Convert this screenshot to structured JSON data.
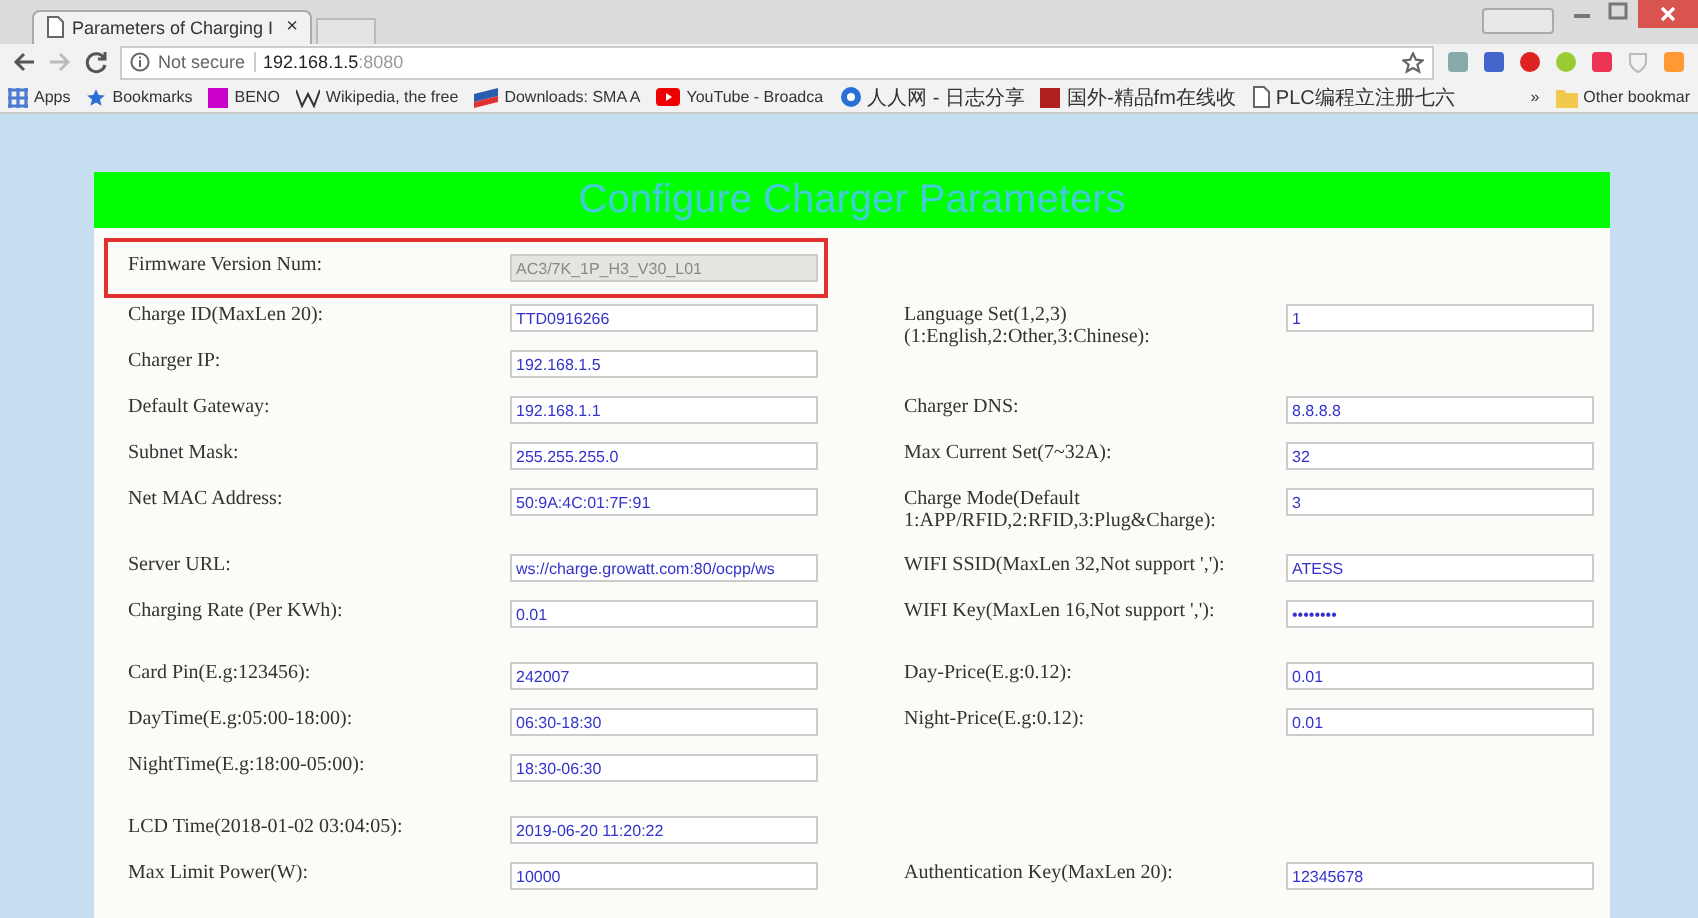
{
  "browser": {
    "tab": {
      "title": "Parameters of Charging I",
      "close": "×"
    },
    "address": {
      "security": "Not secure",
      "host": "192.168.1.5",
      "port": ":8080"
    },
    "bookmarks": [
      {
        "label": "Apps",
        "kind": "apps"
      },
      {
        "label": "Bookmarks",
        "kind": "star"
      },
      {
        "label": "BENO",
        "kind": "square",
        "color": "#cc00cc"
      },
      {
        "label": "Wikipedia, the free",
        "kind": "wiki"
      },
      {
        "label": "Downloads: SMA A",
        "kind": "flag"
      },
      {
        "label": "YouTube - Broadca",
        "kind": "play"
      },
      {
        "label": "人人网 - 日志分享",
        "kind": "globe"
      },
      {
        "label": "国外-精品fm在线收",
        "kind": "square",
        "color": "#b02020"
      },
      {
        "label": "PLC编程立注册七六",
        "kind": "page"
      }
    ],
    "more": "»",
    "other": "Other bookmar"
  },
  "page": {
    "title": "Configure Charger Parameters",
    "groups": [
      {
        "rows": [
          {
            "left": {
              "label": "Firmware Version Num:",
              "value": "AC3/7K_1P_H3_V30_L01",
              "disabled": true,
              "highlighted": true
            }
          },
          {
            "left": {
              "label": "Charge ID(MaxLen 20):",
              "value": "TTD0916266"
            },
            "right": {
              "label": "Language Set(1,2,3)\n(1:English,2:Other,3:Chinese):",
              "value": "1"
            }
          },
          {
            "left": {
              "label": "Charger IP:",
              "value": "192.168.1.5"
            }
          },
          {
            "left": {
              "label": "Default Gateway:",
              "value": "192.168.1.1"
            },
            "right": {
              "label": "Charger DNS:",
              "value": "8.8.8.8"
            }
          },
          {
            "left": {
              "label": "Subnet Mask:",
              "value": "255.255.255.0"
            },
            "right": {
              "label": "Max Current Set(7~32A):",
              "value": "32"
            }
          },
          {
            "left": {
              "label": "Net MAC Address:",
              "value": "50:9A:4C:01:7F:91"
            },
            "right": {
              "label": "Charge Mode(Default\n1:APP/RFID,2:RFID,3:Plug&Charge):",
              "value": "3"
            }
          }
        ]
      },
      {
        "rows": [
          {
            "left": {
              "label": "Server URL:",
              "value": "ws://charge.growatt.com:80/ocpp/ws"
            },
            "right": {
              "label": "WIFI SSID(MaxLen 32,Not support ','):",
              "value": "ATESS"
            }
          },
          {
            "left": {
              "label": "Charging Rate (Per KWh):",
              "value": "0.01"
            },
            "right": {
              "label": "WIFI Key(MaxLen 16,Not support ','):",
              "value": "••••••••"
            }
          }
        ]
      },
      {
        "rows": [
          {
            "left": {
              "label": "Card Pin(E.g:123456):",
              "value": "242007"
            },
            "right": {
              "label": "Day-Price(E.g:0.12):",
              "value": "0.01"
            }
          },
          {
            "left": {
              "label": "DayTime(E.g:05:00-18:00):",
              "value": "06:30-18:30"
            },
            "right": {
              "label": "Night-Price(E.g:0.12):",
              "value": "0.01"
            }
          },
          {
            "left": {
              "label": "NightTime(E.g:18:00-05:00):",
              "value": "18:30-06:30"
            }
          }
        ]
      },
      {
        "rows": [
          {
            "left": {
              "label": "LCD Time(2018-01-02 03:04:05):",
              "value": "2019-06-20 11:20:22"
            }
          },
          {
            "left": {
              "label": "Max Limit Power(W):",
              "value": "10000"
            },
            "right": {
              "label": "Authentication Key(MaxLen 20):",
              "value": "12345678"
            }
          }
        ]
      }
    ]
  }
}
